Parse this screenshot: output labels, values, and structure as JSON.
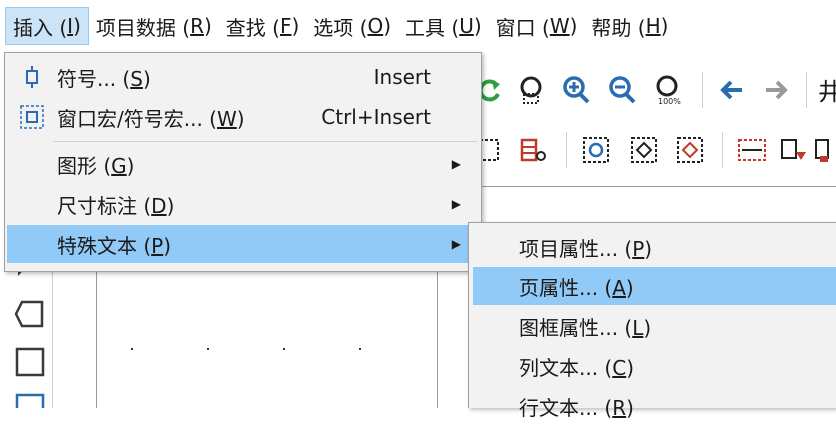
{
  "menubar": {
    "items": [
      {
        "text": "插入 (",
        "key": "I",
        "end": ")"
      },
      {
        "text": "项目数据 (",
        "key": "R",
        "end": ")"
      },
      {
        "text": "查找 (",
        "key": "F",
        "end": ")"
      },
      {
        "text": "选项 (",
        "key": "O",
        "end": ")"
      },
      {
        "text": "工具 (",
        "key": "U",
        "end": ")"
      },
      {
        "text": "窗口 (",
        "key": "W",
        "end": ")"
      },
      {
        "text": "帮助 (",
        "key": "H",
        "end": ")"
      }
    ]
  },
  "insert_menu": {
    "items": [
      {
        "text": "符号... (",
        "key": "S",
        "end": ")",
        "shortcut": "Insert"
      },
      {
        "text": "窗口宏/符号宏... (",
        "key": "W",
        "end": ")",
        "shortcut": "Ctrl+Insert"
      },
      {
        "text": "图形 (",
        "key": "G",
        "end": ")"
      },
      {
        "text": "尺寸标注 (",
        "key": "D",
        "end": ")"
      },
      {
        "text": "特殊文本 (",
        "key": "P",
        "end": ")"
      }
    ]
  },
  "special_text_submenu": {
    "items": [
      {
        "text": "项目属性... (",
        "key": "P",
        "end": ")"
      },
      {
        "text": "页属性... (",
        "key": "A",
        "end": ")"
      },
      {
        "text": "图框属性... (",
        "key": "L",
        "end": ")"
      },
      {
        "text": "列文本... (",
        "key": "C",
        "end": ")"
      },
      {
        "text": "行文本... (",
        "key": "R",
        "end": ")"
      }
    ]
  },
  "toolbar_partial_text": "井",
  "colors": {
    "highlight": "#91c9f7",
    "menu_bg": "#f2f2f2",
    "active_menubar_bg": "#cce4f7",
    "icon_blue": "#2b6cb0",
    "icon_red": "#c0392b"
  }
}
